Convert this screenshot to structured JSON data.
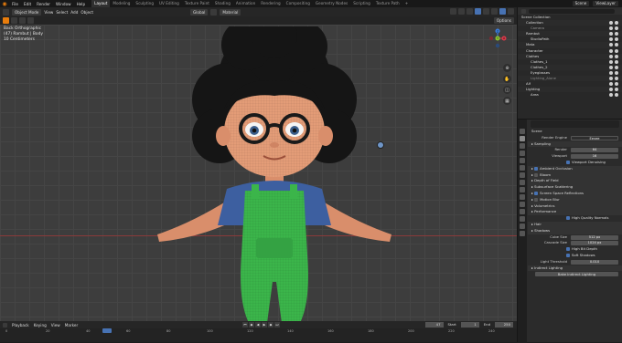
{
  "menu": {
    "items": [
      "File",
      "Edit",
      "Render",
      "Window",
      "Help"
    ]
  },
  "workspaces": [
    "Layout",
    "Modeling",
    "Sculpting",
    "UV Editing",
    "Texture Paint",
    "Shading",
    "Animation",
    "Rendering",
    "Compositing",
    "Geometry Nodes",
    "Scripting",
    "Texture Path"
  ],
  "workspace_add": "+",
  "top_right": {
    "scene": "Scene",
    "view_layer": "ViewLayer"
  },
  "viewport_header": {
    "mode": "Object Mode",
    "view": "View",
    "select": "Select",
    "add": "Add",
    "object": "Object",
    "transform": "Global",
    "pivot": "Material",
    "options": "Options"
  },
  "viewport": {
    "view_name": "Back Orthographic",
    "collection_info": "(47) Rambut | Body",
    "scale_info": "10 Centimeters"
  },
  "gizmo_axes": {
    "x": "X",
    "y": "Y",
    "z": "Z"
  },
  "timeline": {
    "playback": "Playback",
    "keying": "Keying",
    "view": "View",
    "marker": "Marker",
    "current_frame": "47",
    "start_label": "Start",
    "start": "1",
    "end_label": "End",
    "end": "250"
  },
  "timeline_ticks": [
    "0",
    "20",
    "40",
    "60",
    "80",
    "100",
    "120",
    "140",
    "160",
    "180",
    "200",
    "220",
    "240"
  ],
  "outliner": {
    "title": "Scene Collection",
    "rows": [
      {
        "label": "Scene Collection",
        "indent": 0,
        "color": "#ddd"
      },
      {
        "label": "Collection",
        "indent": 1,
        "color": "#ddd"
      },
      {
        "label": "Camera",
        "indent": 2,
        "color": "#9a9a9a"
      },
      {
        "label": "Rambut",
        "indent": 1,
        "color": "#ddd"
      },
      {
        "label": "StudioPath",
        "indent": 2,
        "color": "#ddd"
      },
      {
        "label": "Mata",
        "indent": 1,
        "color": "#ddd"
      },
      {
        "label": "Character",
        "indent": 1,
        "color": "#ddd"
      },
      {
        "label": "Clothes",
        "indent": 1,
        "color": "#ddd"
      },
      {
        "label": "Clothes_1",
        "indent": 2,
        "color": "#ddd"
      },
      {
        "label": "Clothes_2",
        "indent": 2,
        "color": "#ddd"
      },
      {
        "label": "Eyeglasses",
        "indent": 2,
        "color": "#ddd"
      },
      {
        "label": "Lighting_Alone",
        "indent": 2,
        "color": "#888"
      },
      {
        "label": "Alf",
        "indent": 1,
        "color": "#ddd"
      },
      {
        "label": "Lighting",
        "indent": 1,
        "color": "#ddd"
      },
      {
        "label": "Area",
        "indent": 2,
        "color": "#ddd"
      }
    ]
  },
  "properties": {
    "scene_label": "Scene",
    "render_engine_label": "Render Engine",
    "render_engine": "Eevee",
    "sections": [
      {
        "label": "Sampling",
        "type": "header"
      },
      {
        "label": "Render",
        "type": "value",
        "value": "64"
      },
      {
        "label": "Viewport",
        "type": "value",
        "value": "16"
      },
      {
        "label": "Viewport Denoising",
        "type": "check"
      },
      {
        "label": "Ambient Occlusion",
        "type": "header-check"
      },
      {
        "label": "Bloom",
        "type": "header-check-off"
      },
      {
        "label": "Depth of Field",
        "type": "header"
      },
      {
        "label": "Subsurface Scattering",
        "type": "header"
      },
      {
        "label": "Screen Space Reflections",
        "type": "header-check"
      },
      {
        "label": "Motion Blur",
        "type": "header-check-off"
      },
      {
        "label": "Volumetrics",
        "type": "header"
      },
      {
        "label": "Performance",
        "type": "header"
      },
      {
        "label": "High Quality Normals",
        "type": "check"
      },
      {
        "label": "Hair",
        "type": "header"
      },
      {
        "label": "Shadows",
        "type": "header"
      },
      {
        "label": "Cube Size",
        "type": "value",
        "value": "512 px"
      },
      {
        "label": "Cascade Size",
        "type": "value",
        "value": "1024 px"
      },
      {
        "label": "High Bit Depth",
        "type": "check"
      },
      {
        "label": "Soft Shadows",
        "type": "check"
      },
      {
        "label": "Light Threshold",
        "type": "value",
        "value": "0.010"
      },
      {
        "label": "Indirect Lighting",
        "type": "header"
      },
      {
        "label": "Bake Indirect Lighting",
        "type": "button"
      }
    ]
  },
  "colors": {
    "accent": "#4772b3",
    "viewport_bg": "#3d3d3d",
    "orange": "#e87d0d"
  }
}
